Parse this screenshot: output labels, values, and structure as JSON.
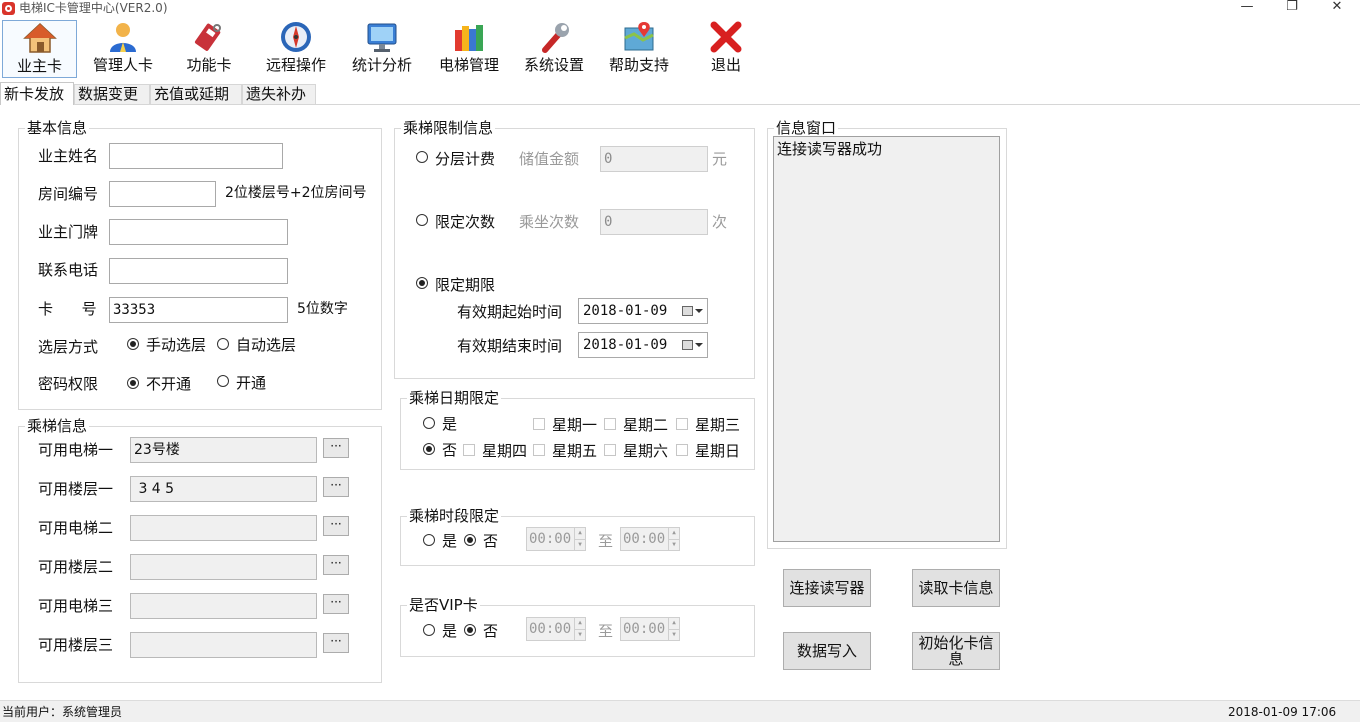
{
  "window": {
    "title": "电梯IC卡管理中心(VER2.0)",
    "minimize": "—",
    "maximize": "❐",
    "close": "✕"
  },
  "toolbar": [
    {
      "label": "业主卡",
      "icon": "house-icon",
      "selected": true
    },
    {
      "label": "管理人卡",
      "icon": "user-icon"
    },
    {
      "label": "功能卡",
      "icon": "card-icon"
    },
    {
      "label": "远程操作",
      "icon": "compass-icon"
    },
    {
      "label": "统计分析",
      "icon": "monitor-icon"
    },
    {
      "label": "电梯管理",
      "icon": "books-icon"
    },
    {
      "label": "系统设置",
      "icon": "wrench-icon"
    },
    {
      "label": "帮助支持",
      "icon": "map-icon"
    },
    {
      "label": "退出",
      "icon": "exit-icon"
    }
  ],
  "tabs": [
    "新卡发放",
    "数据变更",
    "充值或延期",
    "遗失补办"
  ],
  "basic": {
    "title": "基本信息",
    "owner_name_label": "业主姓名",
    "owner_name": "",
    "room_label": "房间编号",
    "room": "",
    "room_hint": "2位楼层号+2位房间号",
    "door_label": "业主门牌",
    "door": "",
    "phone_label": "联系电话",
    "phone": "",
    "card_label": "卡      号",
    "card": "33353",
    "card_hint": "5位数字",
    "floor_mode_label": "选层方式",
    "floor_mode_manual": "手动选层",
    "floor_mode_auto": "自动选层",
    "pwd_label": "密码权限",
    "pwd_off": "不开通",
    "pwd_on": "开通"
  },
  "elevator": {
    "title": "乘梯信息",
    "rows": [
      {
        "label": "可用电梯一",
        "value": "23号楼"
      },
      {
        "label": "可用楼层一",
        "value": " 3 4 5"
      },
      {
        "label": "可用电梯二",
        "value": ""
      },
      {
        "label": "可用楼层二",
        "value": ""
      },
      {
        "label": "可用电梯三",
        "value": ""
      },
      {
        "label": "可用楼层三",
        "value": ""
      }
    ],
    "dots": "···"
  },
  "limit": {
    "title": "乘梯限制信息",
    "per_floor": "分层计费",
    "balance_label": "储值金额",
    "balance": "0",
    "yuan": "元",
    "limit_count": "限定次数",
    "count_label": "乘坐次数",
    "count": "0",
    "ci": "次",
    "limit_period": "限定期限",
    "start_label": "有效期起始时间",
    "start": "2018-01-09",
    "end_label": "有效期结束时间",
    "end": "2018-01-09"
  },
  "date_limit": {
    "title": "乘梯日期限定",
    "yes": "是",
    "no": "否",
    "days1": [
      "星期一",
      "星期二",
      "星期三"
    ],
    "days2": [
      "星期四",
      "星期五",
      "星期六",
      "星期日"
    ]
  },
  "time_limit": {
    "title": "乘梯时段限定",
    "yes": "是",
    "no": "否",
    "from": "00:00",
    "to_label": "至",
    "to": "00:00"
  },
  "vip": {
    "title": "是否VIP卡",
    "yes": "是",
    "no": "否",
    "from": "00:00",
    "to_label": "至",
    "to": "00:00"
  },
  "info": {
    "title": "信息窗口",
    "message": "连接读写器成功"
  },
  "buttons": {
    "connect": "连接读写器",
    "read": "读取卡信息",
    "write": "数据写入",
    "init": "初始化卡信息"
  },
  "status": {
    "user": "当前用户：系统管理员",
    "datetime": "2018-01-09 17:06"
  }
}
